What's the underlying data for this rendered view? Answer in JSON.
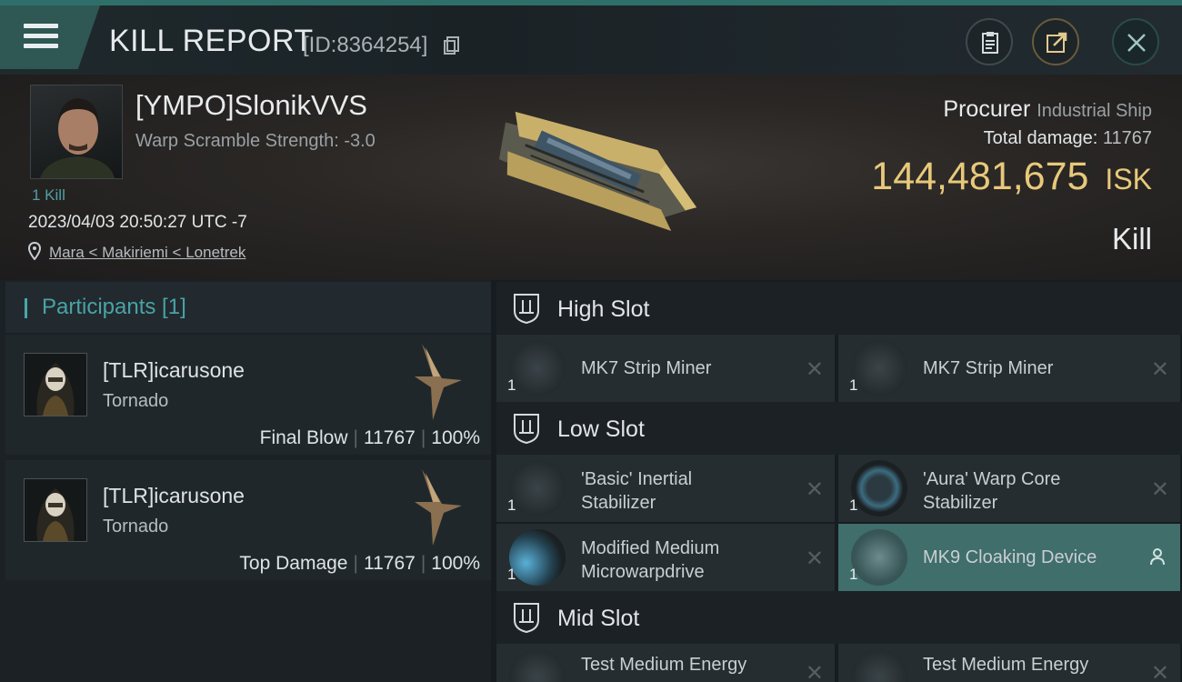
{
  "header": {
    "title": "KILL REPORT",
    "report_id": "[ID:8364254]"
  },
  "victim": {
    "name": "[YMPO]SlonikVVS",
    "warp_scramble": "Warp Scramble Strength: -3.0",
    "kills": "1 Kill",
    "datetime": "2023/04/03 20:50:27 UTC -7",
    "location": "Mara < Makiriemi < Lonetrek"
  },
  "ship": {
    "name": "Procurer",
    "class": "Industrial Ship",
    "total_damage_label": "Total damage:",
    "total_damage": "11767",
    "isk_value": "144,481,675",
    "isk_unit": "ISK",
    "kind": "Kill"
  },
  "participants": {
    "title": "Participants [1]",
    "items": [
      {
        "name": "[TLR]icarusone",
        "ship": "Tornado",
        "label": "Final Blow",
        "damage": "11767",
        "percent": "100%"
      },
      {
        "name": "[TLR]icarusone",
        "ship": "Tornado",
        "label": "Top Damage",
        "damage": "11767",
        "percent": "100%"
      }
    ]
  },
  "slots": {
    "high": {
      "title": "High Slot",
      "modules": [
        {
          "name": "MK7 Strip Miner",
          "qty": "1"
        },
        {
          "name": "MK7 Strip Miner",
          "qty": "1"
        }
      ]
    },
    "low": {
      "title": "Low Slot",
      "modules": [
        {
          "name_l1": "'Basic' Inertial",
          "name_l2": "Stabilizer",
          "qty": "1"
        },
        {
          "name_l1": "'Aura' Warp Core",
          "name_l2": "Stabilizer",
          "qty": "1"
        },
        {
          "name_l1": "Modified Medium",
          "name_l2": "Microwarpdrive",
          "qty": "1"
        },
        {
          "name": "MK9 Cloaking Device",
          "qty": "1"
        }
      ]
    },
    "mid": {
      "title": "Mid Slot",
      "modules": [
        {
          "name": "Test Medium Energy"
        },
        {
          "name": "Test Medium Energy"
        }
      ]
    }
  },
  "icons": [
    "menu-icon",
    "copy-icon",
    "clipboard-icon",
    "share-icon",
    "close-icon",
    "location-pin-icon",
    "slot-icon",
    "remove-icon",
    "user-icon"
  ]
}
